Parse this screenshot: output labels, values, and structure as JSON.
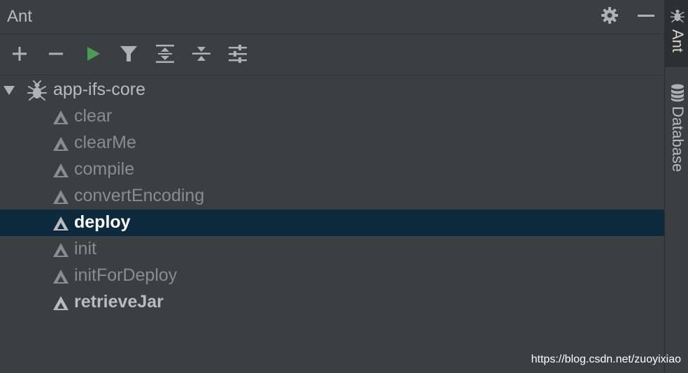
{
  "panel": {
    "title": "Ant",
    "header_icons": [
      "gear-icon",
      "minimize-icon"
    ]
  },
  "toolbar": {
    "buttons": [
      {
        "name": "add-icon"
      },
      {
        "name": "remove-icon"
      },
      {
        "name": "run-icon"
      },
      {
        "name": "filter-icon"
      },
      {
        "name": "expand-all-icon"
      },
      {
        "name": "collapse-all-icon"
      },
      {
        "name": "properties-icon"
      }
    ]
  },
  "tree": {
    "root": {
      "label": "app-ifs-core",
      "icon": "ant-icon",
      "expanded": true
    },
    "targets": [
      {
        "label": "clear",
        "style": "normal"
      },
      {
        "label": "clearMe",
        "style": "normal"
      },
      {
        "label": "compile",
        "style": "normal"
      },
      {
        "label": "convertEncoding",
        "style": "normal"
      },
      {
        "label": "deploy",
        "style": "selected"
      },
      {
        "label": "init",
        "style": "normal"
      },
      {
        "label": "initForDeploy",
        "style": "normal"
      },
      {
        "label": "retrieveJar",
        "style": "bold"
      }
    ]
  },
  "side_tabs": {
    "ant": "Ant",
    "database": "Database"
  },
  "watermark": "https://blog.csdn.net/zuoyixiao",
  "colors": {
    "background": "#3c3f41",
    "selection": "#0d293e",
    "run_green": "#499c54",
    "text": "#bbbbbb",
    "dim_text": "#8a8c8e"
  }
}
